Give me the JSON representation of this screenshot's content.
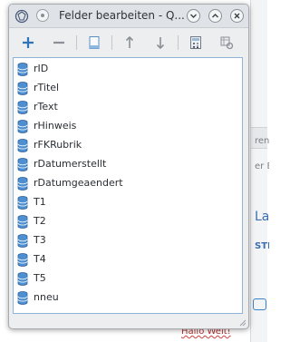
{
  "window": {
    "title": "Felder bearbeiten - Q..."
  },
  "toolbar": {
    "buttons": [
      {
        "name": "add-field-button",
        "icon": "plus-icon"
      },
      {
        "name": "remove-field-button",
        "icon": "minus-icon"
      },
      {
        "name": "edit-field-button",
        "icon": "document-icon"
      },
      {
        "name": "move-up-button",
        "icon": "arrow-up-icon"
      },
      {
        "name": "move-down-button",
        "icon": "arrow-down-icon"
      },
      {
        "name": "calculator-button",
        "icon": "calculator-icon"
      },
      {
        "name": "settings-button",
        "icon": "table-settings-icon"
      }
    ]
  },
  "fields": [
    {
      "label": "rID"
    },
    {
      "label": "rTitel"
    },
    {
      "label": "rText"
    },
    {
      "label": "rHinweis"
    },
    {
      "label": "rFKRubrik"
    },
    {
      "label": "rDatumerstellt"
    },
    {
      "label": "rDatumgeaendert"
    },
    {
      "label": "T1"
    },
    {
      "label": "T2"
    },
    {
      "label": "T3"
    },
    {
      "label": "T4"
    },
    {
      "label": "T5"
    },
    {
      "label": "nneu"
    }
  ],
  "background": {
    "fragment_1": "ren-",
    "fragment_2": "er Ber",
    "fragment_3": "La",
    "fragment_4": "STEL",
    "fragment_5": "Hallo Welt!"
  },
  "colors": {
    "accent": "#3b82c8",
    "list_border": "#8fb3d6"
  }
}
